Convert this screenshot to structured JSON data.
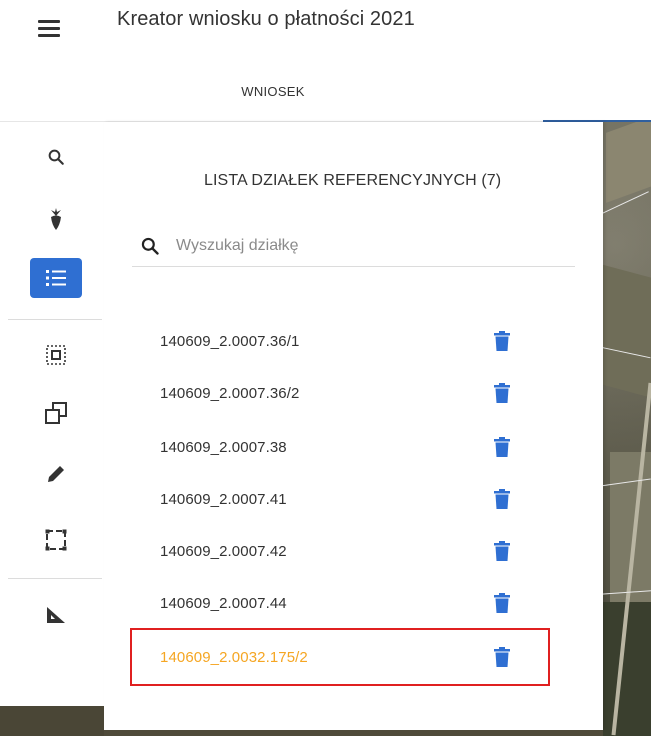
{
  "header": {
    "title": "Kreator wniosku o płatności 2021",
    "tab_label": "WNIOSEK"
  },
  "toolbar": {
    "tools": [
      {
        "icon": "search-icon"
      },
      {
        "icon": "plant-icon"
      },
      {
        "icon": "list-icon",
        "active": true
      },
      {
        "icon": "select-area-icon"
      },
      {
        "icon": "copy-icon"
      },
      {
        "icon": "pencil-icon"
      },
      {
        "icon": "dashed-rectangle-icon"
      },
      {
        "icon": "measure-icon"
      }
    ]
  },
  "panel": {
    "title": "LISTA DZIAŁEK REFERENCYJNYCH (7)",
    "search_placeholder": "Wyszukaj działkę",
    "items": [
      {
        "label": "140609_2.0007.36/1"
      },
      {
        "label": "140609_2.0007.36/2"
      },
      {
        "label": "140609_2.0007.38"
      },
      {
        "label": "140609_2.0007.41"
      },
      {
        "label": "140609_2.0007.42"
      },
      {
        "label": "140609_2.0007.44"
      },
      {
        "label": "140609_2.0032.175/2",
        "highlighted": true
      }
    ]
  },
  "colors": {
    "accent": "#2f6fd2",
    "trash": "#2f6fd2",
    "highlight_text": "#f5a623",
    "highlight_border": "#e02020"
  }
}
